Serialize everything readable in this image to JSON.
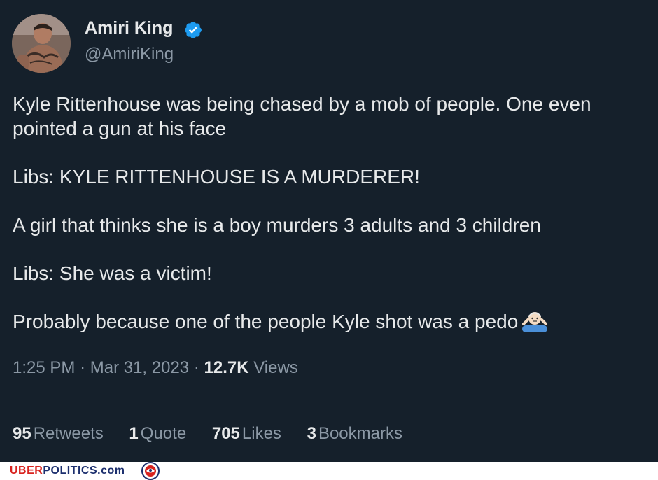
{
  "tweet": {
    "author": {
      "display_name": "Amiri King",
      "handle": "@AmiriKing",
      "verified_icon": "verified-badge-icon",
      "avatar": "profile-photo"
    },
    "paragraphs": [
      "Kyle Rittenhouse was being chased by a mob of people. One even pointed a gun at his face",
      "Libs: KYLE RITTENHOUSE IS A MURDERER!",
      "A girl that thinks she is a boy murders 3 adults and 3 children",
      "Libs: She was a victim!",
      "Probably because one of the people Kyle shot was a pedo"
    ],
    "trailing_emoji": "person-shrugging-emoji",
    "meta": {
      "time": "1:25 PM",
      "separator": "·",
      "date": "Mar 31, 2023",
      "views_count": "12.7K",
      "views_label": "Views"
    },
    "stats": {
      "retweets": {
        "count": "95",
        "label": "Retweets"
      },
      "quotes": {
        "count": "1",
        "label": "Quote"
      },
      "likes": {
        "count": "705",
        "label": "Likes"
      },
      "bookmarks": {
        "count": "3",
        "label": "Bookmarks"
      }
    }
  },
  "watermark": {
    "part1": "UBER",
    "part2": "POLITICS",
    "part3": ".com",
    "logo_icon": "eagle-seal-logo"
  },
  "colors": {
    "background": "#15202b",
    "text_primary": "#e7e9ea",
    "text_secondary": "#8b98a5",
    "verified_blue": "#1d9bf0",
    "divider": "#38444d"
  }
}
